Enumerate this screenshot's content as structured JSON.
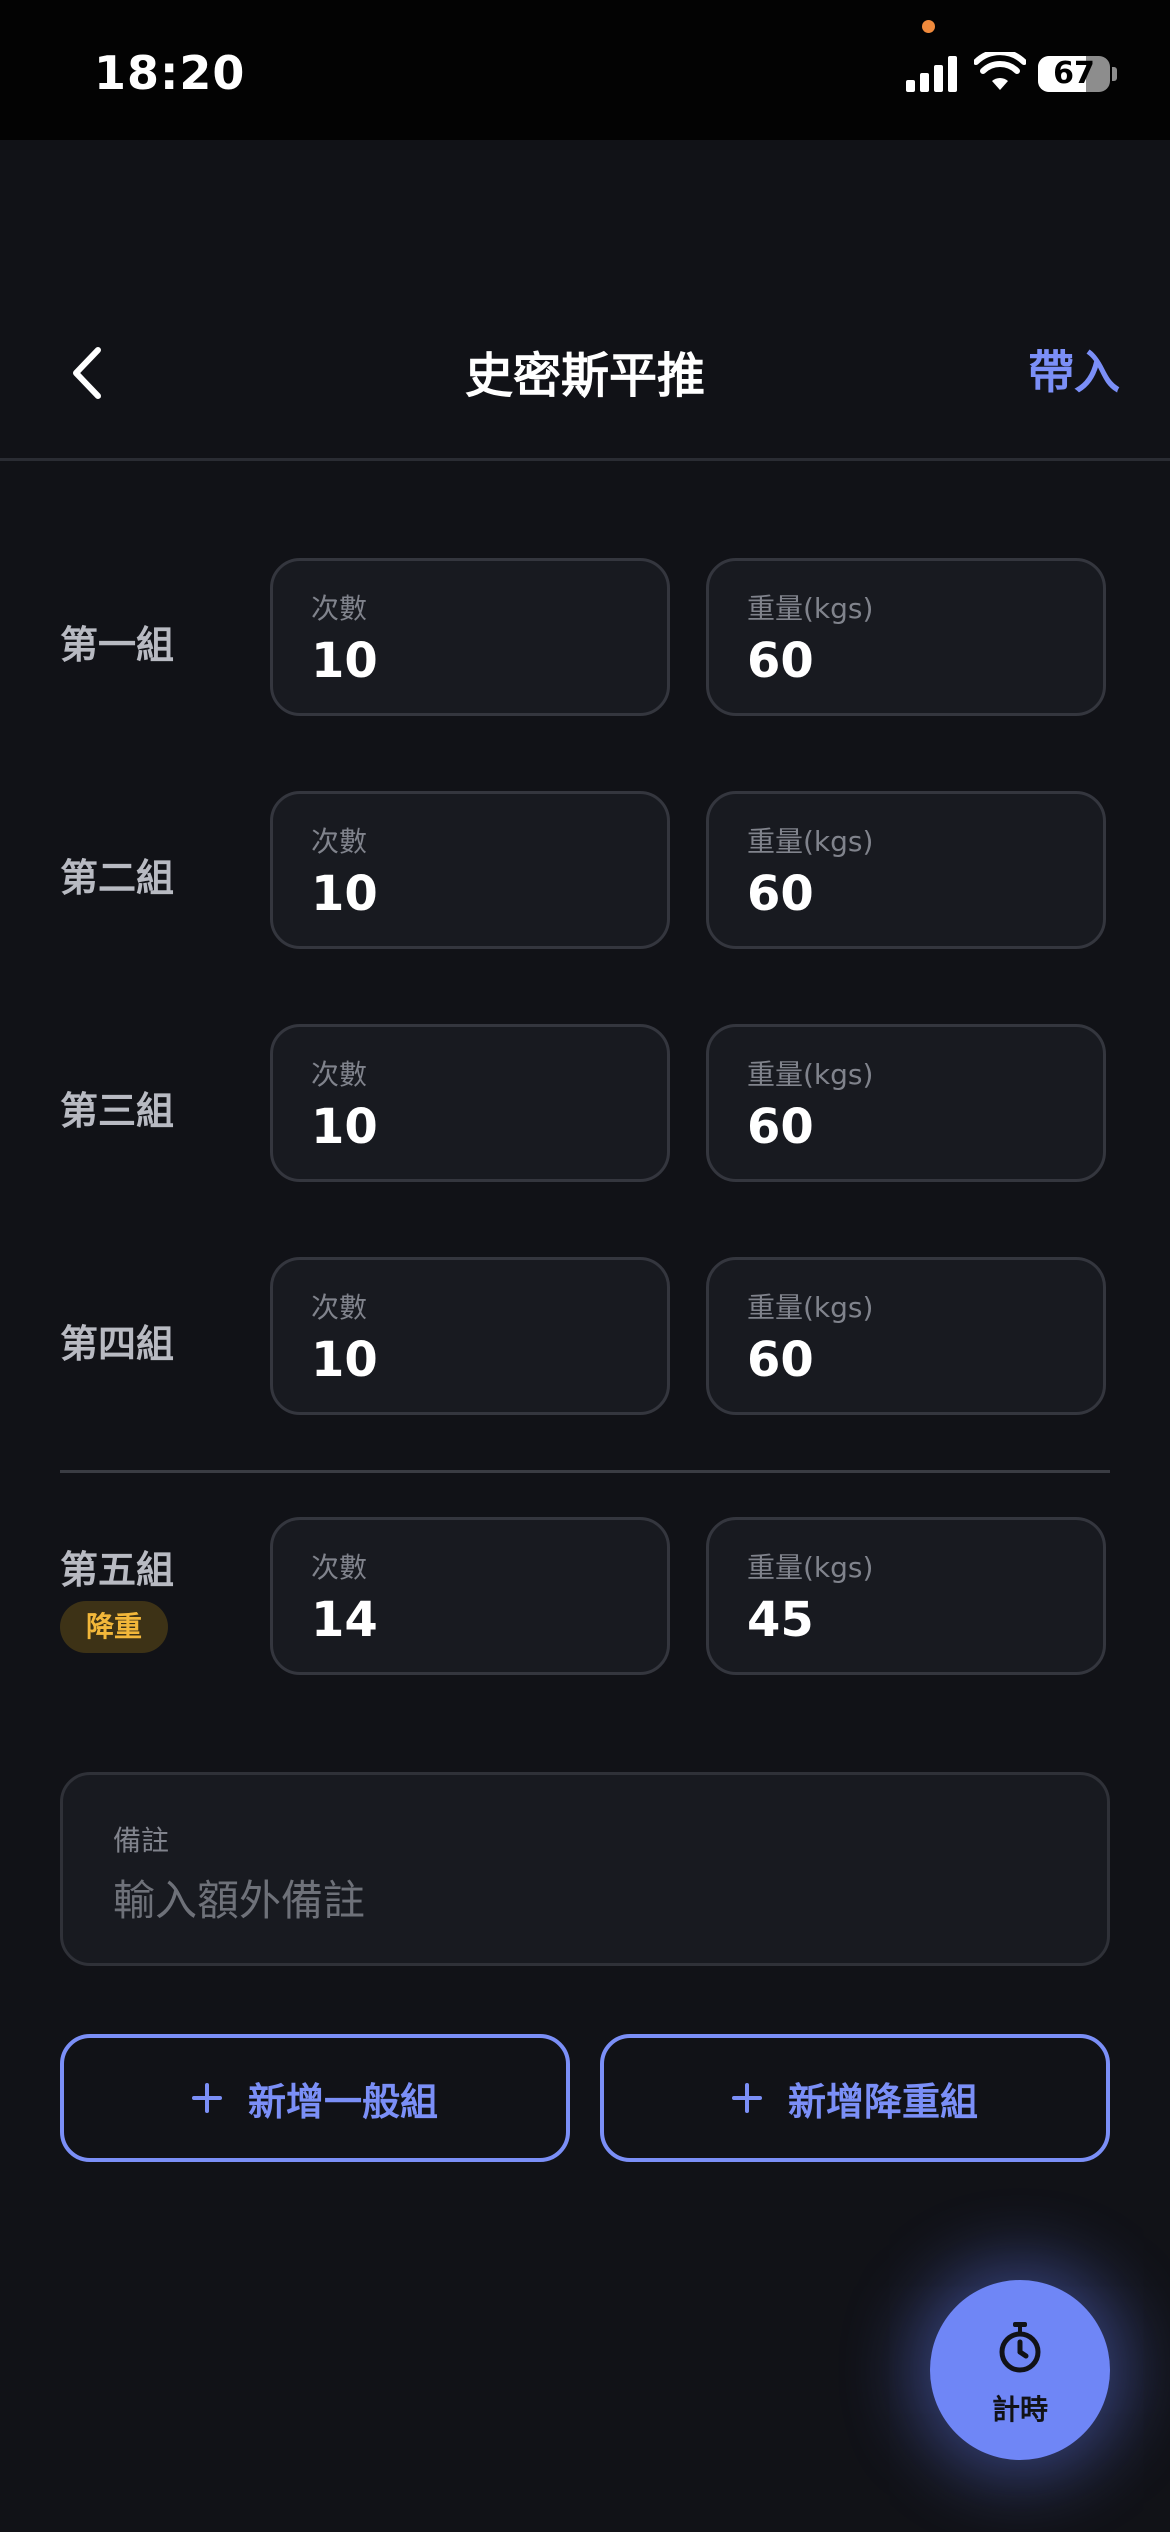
{
  "status_bar": {
    "time": "18:20",
    "battery": "67",
    "battery_level": 0.67
  },
  "header": {
    "title": "史密斯平推",
    "action_label": "帶入",
    "back_icon": "chevron-left-icon"
  },
  "sets": [
    {
      "label": "第一組",
      "reps_label": "次數",
      "reps": "10",
      "weight_label": "重量(kgs)",
      "weight": "60"
    },
    {
      "label": "第二組",
      "reps_label": "次數",
      "reps": "10",
      "weight_label": "重量(kgs)",
      "weight": "60"
    },
    {
      "label": "第三組",
      "reps_label": "次數",
      "reps": "10",
      "weight_label": "重量(kgs)",
      "weight": "60"
    },
    {
      "label": "第四組",
      "reps_label": "次數",
      "reps": "10",
      "weight_label": "重量(kgs)",
      "weight": "60"
    },
    {
      "label": "第五組",
      "badge": "降重",
      "reps_label": "次數",
      "reps": "14",
      "weight_label": "重量(kgs)",
      "weight": "45"
    }
  ],
  "notes": {
    "label": "備註",
    "placeholder": "輸入額外備註"
  },
  "buttons": {
    "add_normal": "新增一般組",
    "add_drop": "新增降重組"
  },
  "timer": {
    "label": "計時",
    "icon": "stopwatch-icon"
  },
  "colors": {
    "accent": "#7b8ff7",
    "background": "#111217",
    "badge_text": "#f2b73a"
  }
}
